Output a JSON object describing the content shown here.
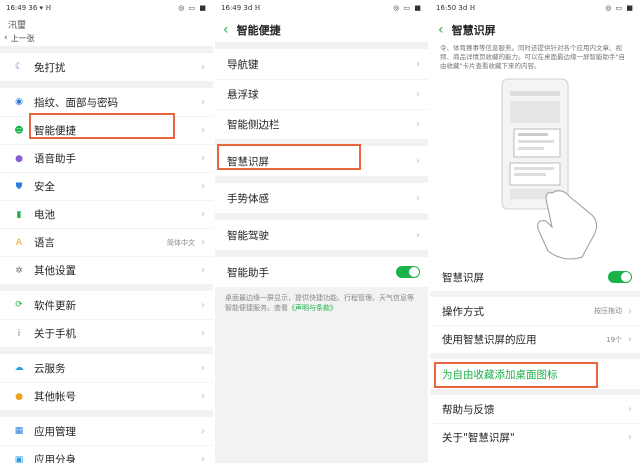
{
  "panel1": {
    "status_time": "16:49",
    "status_signal": "36 ▾ ℍ",
    "status_right": "◎ ▭ ■",
    "cut_title": "汛璽",
    "back_label": "上一张",
    "groups": [
      [
        {
          "label": "免打扰",
          "icon": "moon-icon",
          "glyph": "☾",
          "color": "#8a5cd6"
        }
      ],
      [
        {
          "label": "指纹、面部与密码",
          "icon": "fingerprint-icon",
          "glyph": "◉",
          "color": "#2a7de1"
        },
        {
          "label": "智能便捷",
          "icon": "smart-assist-icon",
          "glyph": "☻",
          "color": "#1cb24b"
        },
        {
          "label": "语音助手",
          "icon": "microphone-icon",
          "glyph": "●",
          "color": "#8a5cd6"
        },
        {
          "label": "安全",
          "icon": "shield-icon",
          "glyph": "⛊",
          "color": "#2a7de1"
        },
        {
          "label": "电池",
          "icon": "battery-icon",
          "glyph": "▮",
          "color": "#1cb24b"
        },
        {
          "label": "语言",
          "icon": "language-icon",
          "glyph": "A",
          "color": "#f0a020",
          "value": "简体中文"
        },
        {
          "label": "其他设置",
          "icon": "gear-icon",
          "glyph": "✲",
          "color": "#777"
        }
      ],
      [
        {
          "label": "软件更新",
          "icon": "update-icon",
          "glyph": "⟳",
          "color": "#1cb24b"
        },
        {
          "label": "关于手机",
          "icon": "info-icon",
          "glyph": "i",
          "color": "#777"
        }
      ],
      [
        {
          "label": "云服务",
          "icon": "cloud-icon",
          "glyph": "☁",
          "color": "#2a9de1"
        },
        {
          "label": "其他帐号",
          "icon": "account-icon",
          "glyph": "●",
          "color": "#f0a020"
        }
      ],
      [
        {
          "label": "应用管理",
          "icon": "apps-icon",
          "glyph": "▦",
          "color": "#2a7de1"
        },
        {
          "label": "应用分身",
          "icon": "app-clone-icon",
          "glyph": "▣",
          "color": "#2a9de1"
        }
      ]
    ]
  },
  "panel2": {
    "status_time": "16:49",
    "status_signal": "3d ℍ",
    "status_right": "◎ ▭ ■",
    "title": "智能便捷",
    "groups": [
      [
        "导航键",
        "悬浮球",
        "智能侧边栏"
      ],
      [
        "智慧识屏"
      ],
      [
        "手势体感"
      ],
      [
        "智能驾驶"
      ]
    ],
    "assistant_label": "智能助手",
    "assistant_desc": "桌面最边缘一屏显示，提供快捷功能、行程管理、天气信息等智能便捷服务。查看",
    "assistant_link": "《声明与条款》"
  },
  "panel3": {
    "status_time": "16:50",
    "status_signal": "3d ℍ",
    "status_right": "◎ ▭ ■",
    "title": "智慧识屏",
    "intro": "令、体育赛事等信息服务。同时还提供针对各个应用内文章、视频、商品详情页收藏的能力。可以在桌面最边缘一屏智能助手\"自由收藏\"卡片查看收藏下来的内容。",
    "toggle_label": "智慧识屏",
    "rows": [
      {
        "label": "操作方式",
        "value": "按压拖动"
      },
      {
        "label": "使用智慧识屏的应用",
        "value": "19个"
      }
    ],
    "add_shortcut": "为自由收藏添加桌面图标",
    "bottom_rows": [
      "帮助与反馈",
      "关于\"智慧识屏\""
    ]
  }
}
